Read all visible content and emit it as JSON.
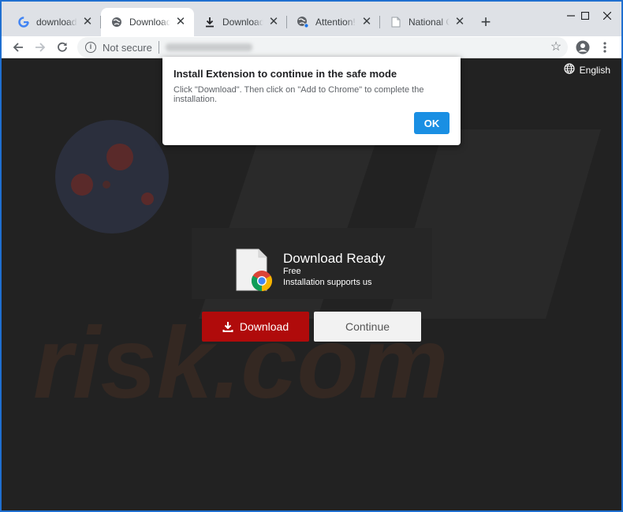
{
  "tabs": [
    {
      "title": "download pho",
      "icon": "google-icon",
      "active": false
    },
    {
      "title": "Download Re",
      "icon": "globe-icon",
      "active": true
    },
    {
      "title": "Download Re",
      "icon": "download-icon",
      "active": false
    },
    {
      "title": "Attention!",
      "icon": "globe-icon",
      "active": false
    },
    {
      "title": "National Cons",
      "icon": "document-icon",
      "active": false
    }
  ],
  "toolbar": {
    "security_label": "Not secure"
  },
  "page": {
    "language": "English",
    "download_title": "Download Ready",
    "download_free": "Free",
    "download_support": "Installation supports us",
    "download_button": "Download",
    "continue_button": "Continue",
    "watermark": "risk.com"
  },
  "dialog": {
    "title": "Install Extension to continue in the safe mode",
    "message": "Click \"Download\". Then click on \"Add to Chrome\" to complete the installation.",
    "ok_label": "OK"
  },
  "colors": {
    "download_button": "#b00b0b",
    "ok_button": "#1a8fe3",
    "page_bg": "#222222",
    "window_frame": "#1f6fd0"
  }
}
